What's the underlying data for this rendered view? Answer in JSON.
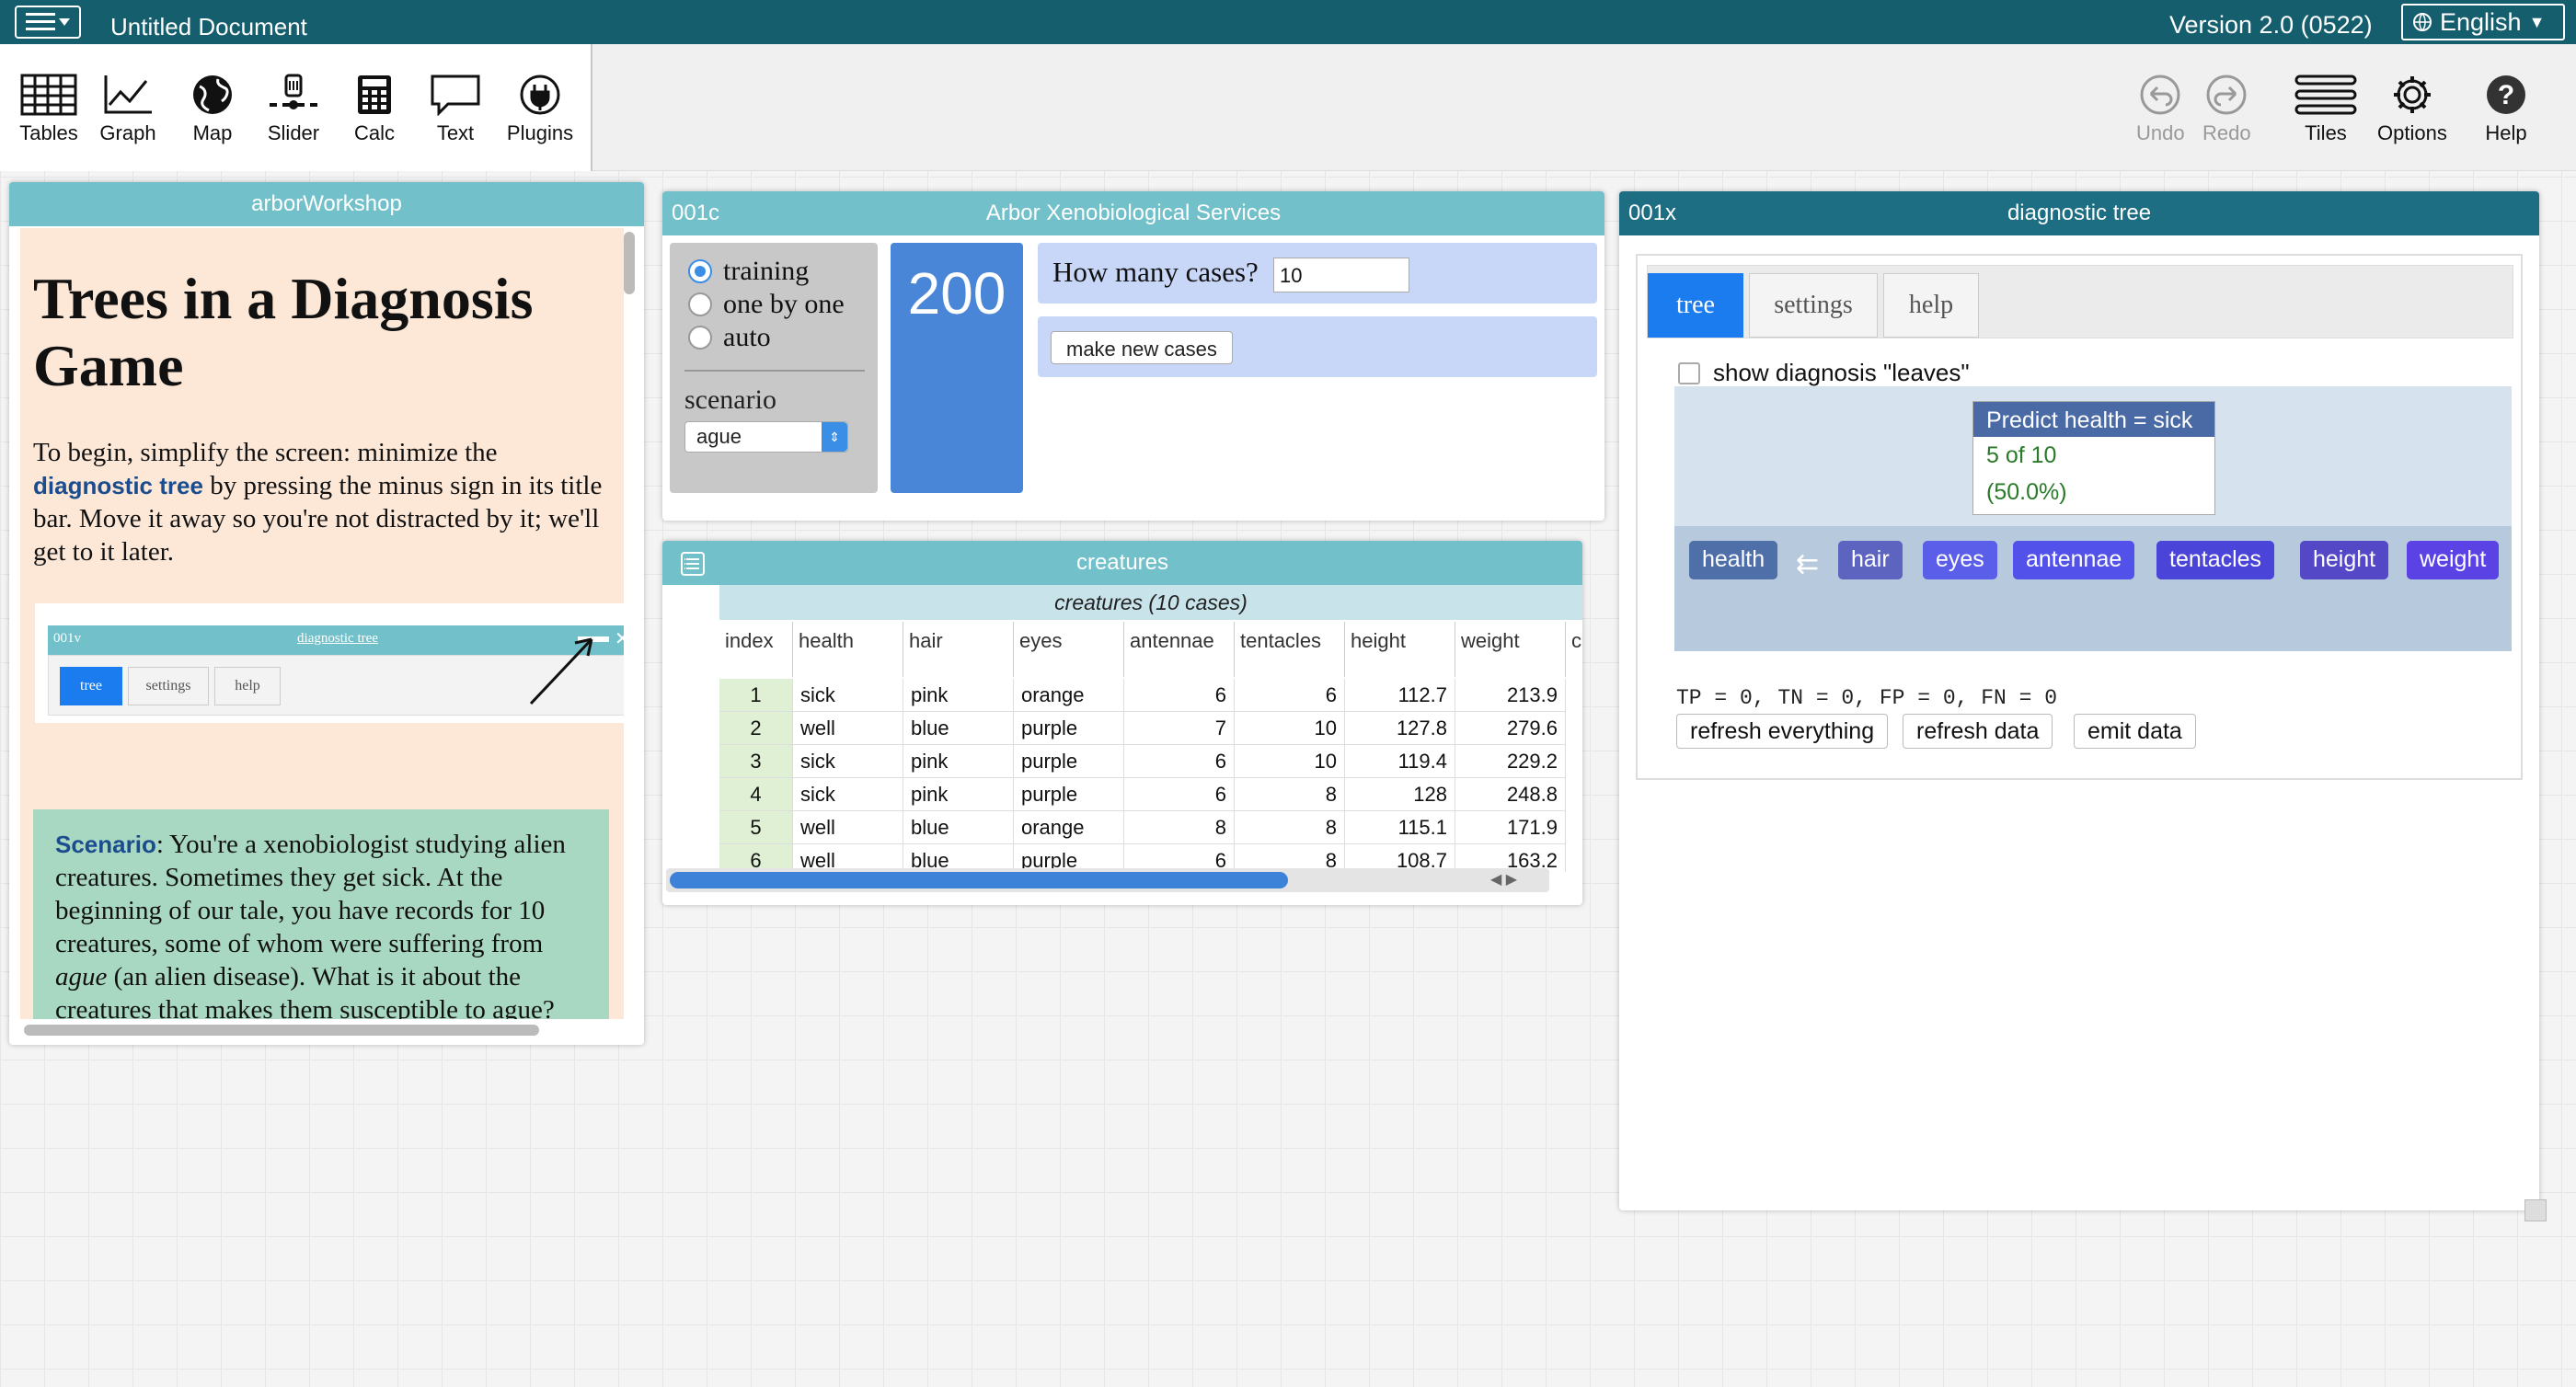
{
  "titlebar": {
    "doc_title": "Untitled Document",
    "version": "Version 2.0 (0522)",
    "language": "English"
  },
  "toolbar": {
    "left": [
      "Tables",
      "Graph",
      "Map",
      "Slider",
      "Calc",
      "Text",
      "Plugins"
    ],
    "right": [
      "Undo",
      "Redo",
      "Tiles",
      "Options",
      "Help"
    ]
  },
  "arbor_panel": {
    "title": "arborWorkshop",
    "heading": "Trees in a Diagnosis Game",
    "p1_a": "To begin, simplify the screen: minimize the ",
    "p1_link": "diagnostic tree",
    "p1_b": " by pressing the minus sign in its title bar. Move it away so you're not distracted by it; we'll get to it later.",
    "mini_id": "001v",
    "mini_title": "diagnostic tree",
    "mini_tabs": [
      "tree",
      "settings",
      "help"
    ],
    "scenario_label": "Scenario",
    "scenario_a": ": You're a xenobiologist studying alien creatures. Sometimes they get sick. At the beginning of our tale, you have records for 10 creatures, some of whom were suffering from ",
    "scenario_em": "ague",
    "scenario_b": " (an alien disease). What is it about the creatures that makes them susceptible to ague?"
  },
  "xeno_panel": {
    "id": "001c",
    "title": "Arbor Xenobiological Services",
    "radios": [
      "training",
      "one by one",
      "auto"
    ],
    "selected_radio": "training",
    "scenario_label": "scenario",
    "scenario_value": "ague",
    "big_number": "200",
    "how_many_label": "How many cases?",
    "how_many_value": "10",
    "make_button": "make new cases"
  },
  "creatures": {
    "title": "creatures",
    "subtitle": "creatures (10 cases)",
    "columns": [
      "index",
      "health",
      "hair",
      "eyes",
      "antennae",
      "tentacles",
      "height",
      "weight",
      "c"
    ],
    "rows": [
      [
        "1",
        "sick",
        "pink",
        "orange",
        "6",
        "6",
        "112.7",
        "213.9"
      ],
      [
        "2",
        "well",
        "blue",
        "purple",
        "7",
        "10",
        "127.8",
        "279.6"
      ],
      [
        "3",
        "sick",
        "pink",
        "purple",
        "6",
        "10",
        "119.4",
        "229.2"
      ],
      [
        "4",
        "sick",
        "pink",
        "purple",
        "6",
        "8",
        "128",
        "248.8"
      ],
      [
        "5",
        "well",
        "blue",
        "orange",
        "8",
        "8",
        "115.1",
        "171.9"
      ],
      [
        "6",
        "well",
        "blue",
        "purple",
        "6",
        "8",
        "108.7",
        "163.2"
      ]
    ]
  },
  "diag_panel": {
    "id": "001x",
    "title": "diagnostic tree",
    "tabs": [
      "tree",
      "settings",
      "help"
    ],
    "active_tab": "tree",
    "show_leaves": "show diagnosis \"leaves\"",
    "predict_title": "Predict health = sick",
    "predict_count": "5 of 10",
    "predict_pct": "(50.0%)",
    "attributes": [
      "health",
      "hair",
      "eyes",
      "antennae",
      "tentacles",
      "height",
      "weight"
    ],
    "stats": "TP = 0, TN = 0, FP = 0, FN = 0",
    "buttons": [
      "refresh everything",
      "refresh data",
      "emit data"
    ]
  },
  "colors": {
    "titlebar": "#145e6e",
    "panel_header": "#72c0c9",
    "diag_header": "#1d6e82",
    "accent_blue": "#1b7cf0"
  }
}
